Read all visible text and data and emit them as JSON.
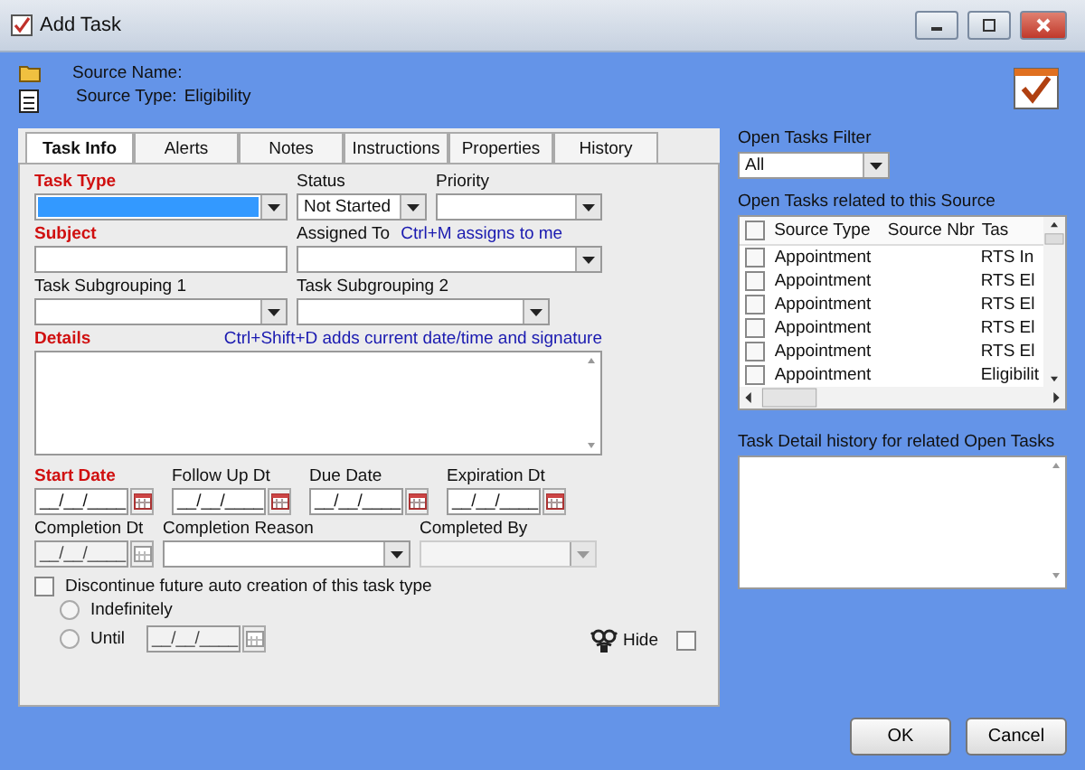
{
  "window": {
    "title": "Add Task"
  },
  "header": {
    "source_name_label": "Source Name:",
    "source_type_label": "Source Type:",
    "source_type_value": "Eligibility"
  },
  "tabs": [
    {
      "label": "Task Info",
      "selected": true
    },
    {
      "label": "Alerts",
      "selected": false
    },
    {
      "label": "Notes",
      "selected": false
    },
    {
      "label": "Instructions",
      "selected": false
    },
    {
      "label": "Properties",
      "selected": false
    },
    {
      "label": "History",
      "selected": false
    }
  ],
  "form": {
    "task_type": {
      "label": "Task Type",
      "required": true,
      "focused": true
    },
    "status": {
      "label": "Status",
      "value": "Not Started"
    },
    "priority": {
      "label": "Priority"
    },
    "subject": {
      "label": "Subject",
      "required": true
    },
    "assigned_to": {
      "label": "Assigned To",
      "hint": "Ctrl+M assigns to me"
    },
    "subgroup_1": {
      "label": "Task Subgrouping 1"
    },
    "subgroup_2": {
      "label": "Task Subgrouping 2"
    },
    "details": {
      "label": "Details",
      "required": true,
      "hint": "Ctrl+Shift+D adds current date/time and signature"
    },
    "dates": [
      {
        "label": "Start Date",
        "value": "__/__/____",
        "required": true,
        "disabled": false
      },
      {
        "label": "Follow Up Dt",
        "value": "__/__/____",
        "required": false,
        "disabled": false
      },
      {
        "label": "Due Date",
        "value": "__/__/____",
        "required": false,
        "disabled": false
      },
      {
        "label": "Expiration Dt",
        "value": "__/__/____",
        "required": false,
        "disabled": false
      }
    ],
    "completion_dt": {
      "label": "Completion Dt",
      "value": "__/__/____",
      "disabled": true
    },
    "completion_reason": {
      "label": "Completion Reason",
      "disabled": false
    },
    "completed_by": {
      "label": "Completed By",
      "disabled": true
    },
    "discontinue": {
      "label": "Discontinue future auto creation of this task type",
      "checked": false
    },
    "indefinitely": {
      "label": "Indefinitely",
      "selected": false
    },
    "until": {
      "label": "Until",
      "selected": false,
      "value": "__/__/____",
      "disabled": true
    },
    "hide": {
      "label": "Hide",
      "checked": false
    }
  },
  "filter": {
    "label": "Open Tasks Filter",
    "value": "All"
  },
  "related": {
    "label": "Open Tasks related to this Source",
    "header_checked": false,
    "columns": [
      "Source Type",
      "Source Nbr",
      "Tas"
    ],
    "rows": [
      {
        "checked": false,
        "cells": [
          "Appointment",
          "",
          "RTS In"
        ]
      },
      {
        "checked": false,
        "cells": [
          "Appointment",
          "",
          "RTS El"
        ]
      },
      {
        "checked": false,
        "cells": [
          "Appointment",
          "",
          "RTS El"
        ]
      },
      {
        "checked": false,
        "cells": [
          "Appointment",
          "",
          "RTS El"
        ]
      },
      {
        "checked": false,
        "cells": [
          "Appointment",
          "",
          "RTS El"
        ]
      },
      {
        "checked": false,
        "cells": [
          "Appointment",
          "",
          "Eligibilit"
        ]
      }
    ]
  },
  "history": {
    "label": "Task Detail history for related Open Tasks"
  },
  "buttons": [
    "OK",
    "Cancel"
  ]
}
